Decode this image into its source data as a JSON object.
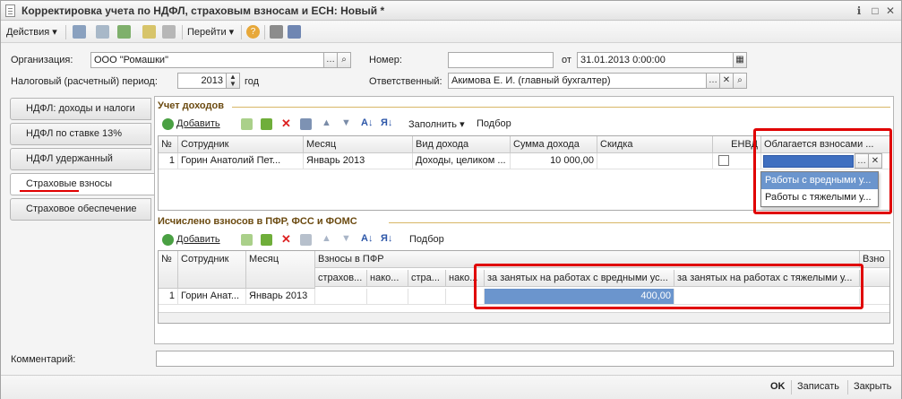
{
  "window": {
    "title": "Корректировка учета по НДФЛ, страховым взносам и ЕСН: Новый *"
  },
  "toolbar": {
    "actions": "Действия",
    "goto": "Перейти"
  },
  "form": {
    "org_label": "Организация:",
    "org_value": "ООО \"Ромашки\"",
    "number_label": "Номер:",
    "number_value": "",
    "from_label": "от",
    "date_value": "31.01.2013  0:00:00",
    "period_label": "Налоговый (расчетный) период:",
    "period_value": "2013",
    "year_label": "год",
    "responsible_label": "Ответственный:",
    "responsible_value": "Акимова Е. И. (главный бухгалтер)",
    "comment_label": "Комментарий:",
    "comment_value": ""
  },
  "tabs": [
    {
      "label": "НДФЛ: доходы и налоги"
    },
    {
      "label": "НДФЛ по ставке 13%"
    },
    {
      "label": "НДФЛ удержанный"
    },
    {
      "label": "Страховые взносы",
      "active": true
    },
    {
      "label": "Страховое обеспечение"
    }
  ],
  "income": {
    "title": "Учет доходов",
    "add": "Добавить",
    "fill": "Заполнить",
    "select": "Подбор",
    "headers": [
      "№",
      "Сотрудник",
      "Месяц",
      "Вид дохода",
      "Сумма дохода",
      "Скидка",
      "ЕНВД",
      "Облагается взносами ..."
    ],
    "row": {
      "n": "1",
      "employee": "Горин Анатолий Пет...",
      "month": "Январь 2013",
      "type": "Доходы, целиком ...",
      "sum": "10 000,00",
      "discount": "",
      "envd": ""
    },
    "dropdown": [
      "Работы с вредными у...",
      "Работы с тяжелыми у..."
    ]
  },
  "contrib": {
    "title": "Исчислено взносов в ПФР, ФСС и ФОМС",
    "add": "Добавить",
    "select": "Подбор",
    "headers": {
      "n": "№",
      "employee": "Сотрудник",
      "month": "Месяц",
      "pfr": "Взносы в ПФР",
      "c1": "страхов...",
      "c2": "нако...",
      "c3": "стра...",
      "c4": "нако...",
      "harmful": "за занятых на работах с вредными ус...",
      "heavy": "за занятых на работах с тяжелыми у...",
      "extra": "Взно"
    },
    "row": {
      "n": "1",
      "employee": "Горин Анат...",
      "month": "Январь 2013",
      "harmful": "400,00"
    }
  },
  "bottom": {
    "ok": "OK",
    "save": "Записать",
    "close": "Закрыть"
  },
  "colors": {
    "highlight": "#e00000",
    "selection": "#6b95cd",
    "section_title": "#6b4a10"
  }
}
